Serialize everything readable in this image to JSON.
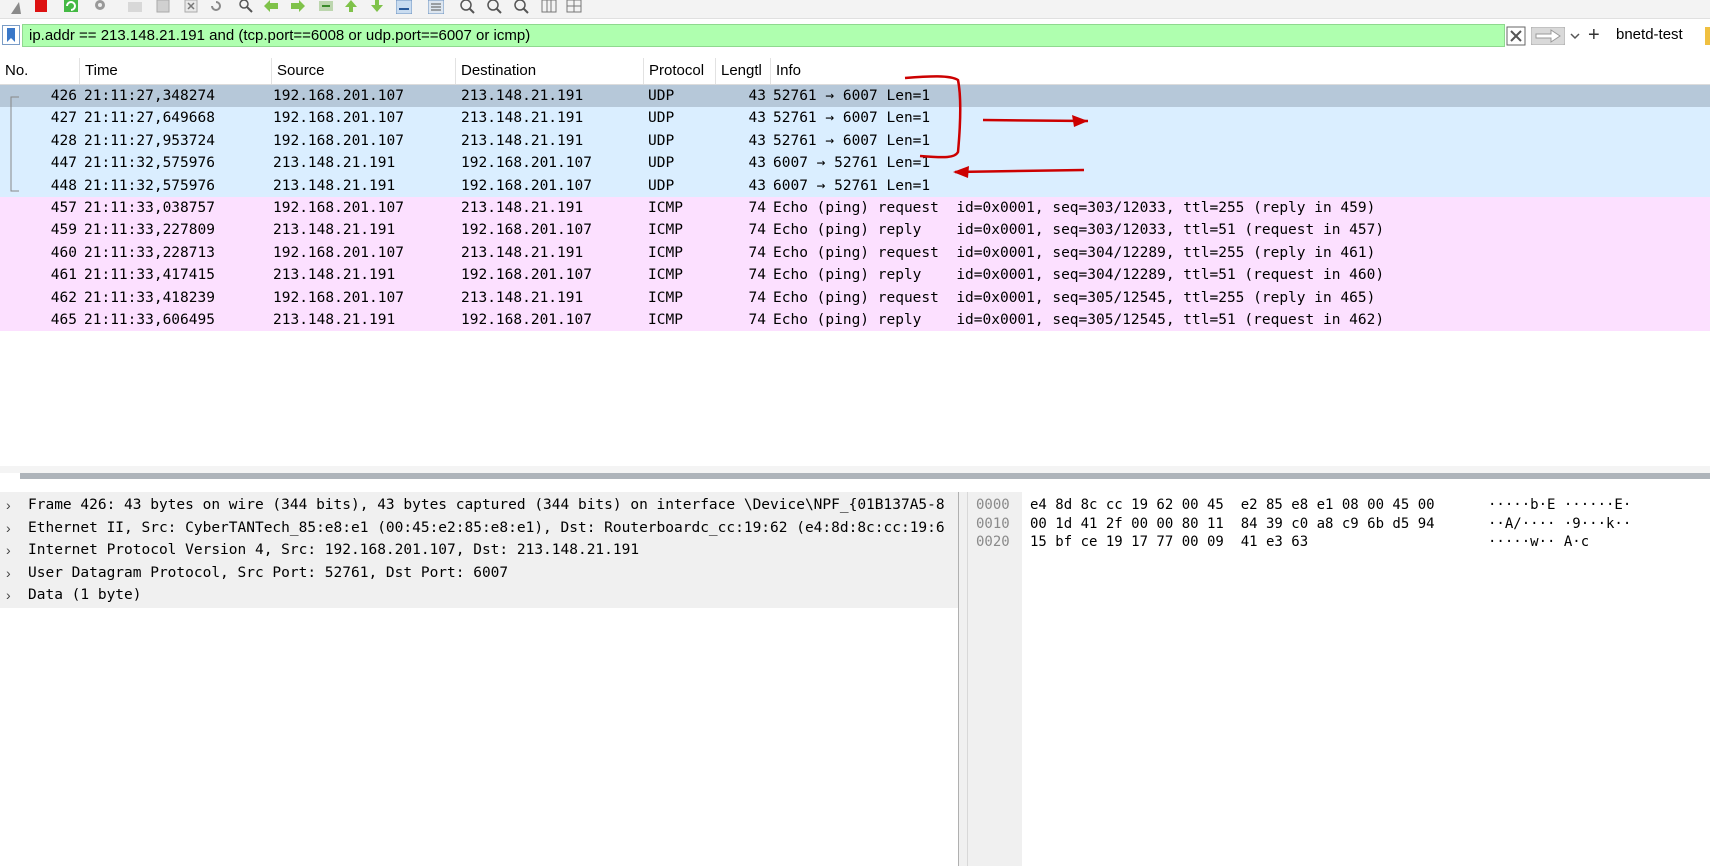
{
  "filter": {
    "value": "ip.addr == 213.148.21.191 and  (tcp.port==6008 or udp.port==6007 or icmp)",
    "button_label": "bnetd-test"
  },
  "columns": [
    {
      "label": "No."
    },
    {
      "label": "Time"
    },
    {
      "label": "Source"
    },
    {
      "label": "Destination"
    },
    {
      "label": "Protocol"
    },
    {
      "label": "Lengtl"
    },
    {
      "label": "Info"
    }
  ],
  "packets": [
    {
      "no": "426",
      "time": "21:11:27,348274",
      "src": "192.168.201.107",
      "dst": "213.148.21.191",
      "proto": "UDP",
      "len": "43",
      "info": "52761 → 6007 Len=1"
    },
    {
      "no": "427",
      "time": "21:11:27,649668",
      "src": "192.168.201.107",
      "dst": "213.148.21.191",
      "proto": "UDP",
      "len": "43",
      "info": "52761 → 6007 Len=1"
    },
    {
      "no": "428",
      "time": "21:11:27,953724",
      "src": "192.168.201.107",
      "dst": "213.148.21.191",
      "proto": "UDP",
      "len": "43",
      "info": "52761 → 6007 Len=1"
    },
    {
      "no": "447",
      "time": "21:11:32,575976",
      "src": "213.148.21.191",
      "dst": "192.168.201.107",
      "proto": "UDP",
      "len": "43",
      "info": "6007 → 52761 Len=1"
    },
    {
      "no": "448",
      "time": "21:11:32,575976",
      "src": "213.148.21.191",
      "dst": "192.168.201.107",
      "proto": "UDP",
      "len": "43",
      "info": "6007 → 52761 Len=1"
    },
    {
      "no": "457",
      "time": "21:11:33,038757",
      "src": "192.168.201.107",
      "dst": "213.148.21.191",
      "proto": "ICMP",
      "len": "74",
      "info": "Echo (ping) request  id=0x0001, seq=303/12033, ttl=255 (reply in 459)"
    },
    {
      "no": "459",
      "time": "21:11:33,227809",
      "src": "213.148.21.191",
      "dst": "192.168.201.107",
      "proto": "ICMP",
      "len": "74",
      "info": "Echo (ping) reply    id=0x0001, seq=303/12033, ttl=51 (request in 457)"
    },
    {
      "no": "460",
      "time": "21:11:33,228713",
      "src": "192.168.201.107",
      "dst": "213.148.21.191",
      "proto": "ICMP",
      "len": "74",
      "info": "Echo (ping) request  id=0x0001, seq=304/12289, ttl=255 (reply in 461)"
    },
    {
      "no": "461",
      "time": "21:11:33,417415",
      "src": "213.148.21.191",
      "dst": "192.168.201.107",
      "proto": "ICMP",
      "len": "74",
      "info": "Echo (ping) reply    id=0x0001, seq=304/12289, ttl=51 (request in 460)"
    },
    {
      "no": "462",
      "time": "21:11:33,418239",
      "src": "192.168.201.107",
      "dst": "213.148.21.191",
      "proto": "ICMP",
      "len": "74",
      "info": "Echo (ping) request  id=0x0001, seq=305/12545, ttl=255 (reply in 465)"
    },
    {
      "no": "465",
      "time": "21:11:33,606495",
      "src": "213.148.21.191",
      "dst": "192.168.201.107",
      "proto": "ICMP",
      "len": "74",
      "info": "Echo (ping) reply    id=0x0001, seq=305/12545, ttl=51 (request in 462)"
    }
  ],
  "details": [
    "Frame 426: 43 bytes on wire (344 bits), 43 bytes captured (344 bits) on interface \\Device\\NPF_{01B137A5-8",
    "Ethernet II, Src: CyberTANTech_85:e8:e1 (00:45:e2:85:e8:e1), Dst: Routerboardc_cc:19:62 (e4:8d:8c:cc:19:6",
    "Internet Protocol Version 4, Src: 192.168.201.107, Dst: 213.148.21.191",
    "User Datagram Protocol, Src Port: 52761, Dst Port: 6007",
    "Data (1 byte)"
  ],
  "bytes": [
    {
      "offset": "0000",
      "hex": "e4 8d 8c cc 19 62 00 45  e2 85 e8 e1 08 00 45 00",
      "ascii": "·····b·E ······E·"
    },
    {
      "offset": "0010",
      "hex": "00 1d 41 2f 00 00 80 11  84 39 c0 a8 c9 6b d5 94",
      "ascii": "··A/···· ·9···k··"
    },
    {
      "offset": "0020",
      "hex": "15 bf ce 19 17 77 00 09  41 e3 63",
      "ascii": "·····w·· A·c"
    }
  ],
  "colors": {
    "filter_bg": "#afffaf",
    "udp_row": "#daeeff",
    "icmp_row": "#fce0ff",
    "selected_row": "#b6c8d9",
    "annotation": "#cc0000"
  }
}
